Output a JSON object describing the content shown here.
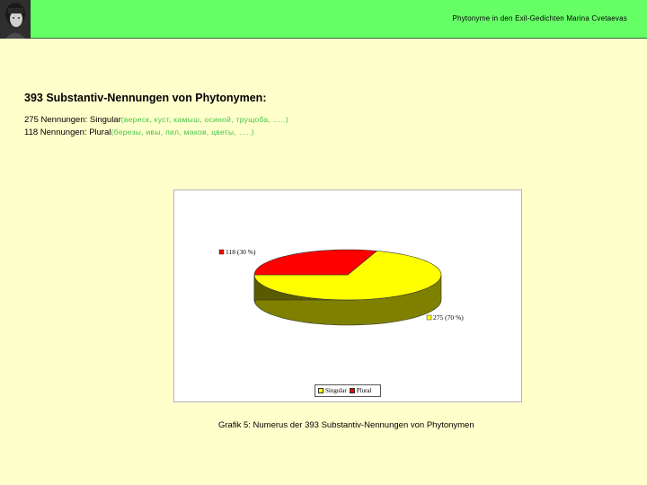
{
  "header": {
    "title": "Phytonyme in den Exil-Gedichten Marina Cvetaevas",
    "background": "#66ff66"
  },
  "main": {
    "heading": "393 Substantiv-Nennungen von Phytonymen:",
    "lines": [
      {
        "prefix": "275 Nennungen: Singular",
        "examples": "(вереск, куст, камыш, осиной, трущоба, …..)"
      },
      {
        "prefix": "118 Nennungen: Plural",
        "examples": "(березы, ивы, пил, маков, цветы, …..)"
      }
    ]
  },
  "chart_data": {
    "type": "pie",
    "categories": [
      "Singular",
      "Plural"
    ],
    "values": [
      275,
      118
    ],
    "data_labels": [
      "275 (70 %)",
      "118 (30 %)"
    ],
    "colors": [
      "#ffff00",
      "#ff0000"
    ],
    "legend": [
      "Singular",
      "Plural"
    ],
    "legend_placement": "bottom"
  },
  "caption": "Grafik 5: Numerus der 393 Substantiv-Nennungen von Phytonymen"
}
